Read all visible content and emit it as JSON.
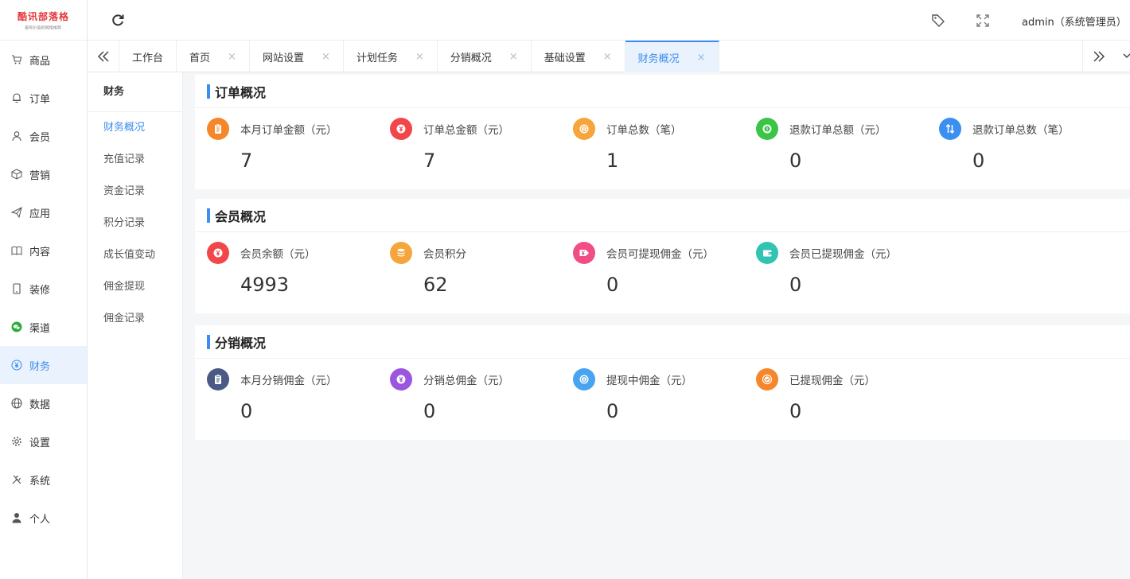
{
  "logo": {
    "main": "酷讯部落格",
    "sub": "最有价值的网络推荐"
  },
  "nav": [
    {
      "name": "nav-goods",
      "icon": "cart-icon",
      "label": "商品"
    },
    {
      "name": "nav-orders",
      "icon": "bell-icon",
      "label": "订单"
    },
    {
      "name": "nav-members",
      "icon": "user-icon",
      "label": "会员"
    },
    {
      "name": "nav-marketing",
      "icon": "cube-icon",
      "label": "营销"
    },
    {
      "name": "nav-apps",
      "icon": "paper-plane-icon",
      "label": "应用"
    },
    {
      "name": "nav-content",
      "icon": "book-icon",
      "label": "内容"
    },
    {
      "name": "nav-decoration",
      "icon": "tablet-icon",
      "label": "装修"
    },
    {
      "name": "nav-channels",
      "icon": "wechat-icon",
      "label": "渠道"
    },
    {
      "name": "nav-finance",
      "icon": "yen-icon",
      "label": "财务"
    },
    {
      "name": "nav-data",
      "icon": "globe-icon",
      "label": "数据"
    },
    {
      "name": "nav-settings",
      "icon": "gear-icon",
      "label": "设置"
    },
    {
      "name": "nav-system",
      "icon": "tools-icon",
      "label": "系统"
    },
    {
      "name": "nav-personal",
      "icon": "person-icon",
      "label": "个人"
    }
  ],
  "topbar": {
    "user": "admin（系统管理员）"
  },
  "tabs": [
    {
      "label": "工作台",
      "closable": false
    },
    {
      "label": "首页",
      "closable": true
    },
    {
      "label": "网站设置",
      "closable": true
    },
    {
      "label": "计划任务",
      "closable": true
    },
    {
      "label": "分销概况",
      "closable": true
    },
    {
      "label": "基础设置",
      "closable": true
    },
    {
      "label": "财务概况",
      "closable": true
    }
  ],
  "tab_close_glyph": "×",
  "submenu": {
    "title": "财务",
    "items": [
      "财务概况",
      "充值记录",
      "资金记录",
      "积分记录",
      "成长值变动",
      "佣金提现",
      "佣金记录"
    ]
  },
  "sections": [
    {
      "title": "订单概况",
      "stats": [
        {
          "label": "本月订单金额（元）",
          "value": "7",
          "icon": "clipboard-icon",
          "color": "#f5862a"
        },
        {
          "label": "订单总金额（元）",
          "value": "7",
          "icon": "yen-icon",
          "color": "#f2474a"
        },
        {
          "label": "订单总数（笔）",
          "value": "1",
          "icon": "coin-icon",
          "color": "#f6a53c"
        },
        {
          "label": "退款订单总额（元）",
          "value": "0",
          "icon": "refund-coin-icon",
          "color": "#3cc447"
        },
        {
          "label": "退款订单总数（笔）",
          "value": "0",
          "icon": "arrows-icon",
          "color": "#3a8ff0"
        }
      ]
    },
    {
      "title": "会员概况",
      "stats": [
        {
          "label": "会员余额（元）",
          "value": "4993",
          "icon": "yen-icon",
          "color": "#f2474a"
        },
        {
          "label": "会员积分",
          "value": "62",
          "icon": "coins-stack-icon",
          "color": "#f6a53c"
        },
        {
          "label": "会员可提现佣金（元）",
          "value": "0",
          "icon": "yen-arrow-icon",
          "color": "#f04e84"
        },
        {
          "label": "会员已提现佣金（元）",
          "value": "0",
          "icon": "wallet-icon",
          "color": "#31c4b3"
        }
      ]
    },
    {
      "title": "分销概况",
      "stats": [
        {
          "label": "本月分销佣金（元）",
          "value": "0",
          "icon": "clipboard-icon",
          "color": "#4b5a85"
        },
        {
          "label": "分销总佣金（元）",
          "value": "0",
          "icon": "yen-icon",
          "color": "#9b55e0"
        },
        {
          "label": "提现中佣金（元）",
          "value": "0",
          "icon": "coin-icon",
          "color": "#48a3f0"
        },
        {
          "label": "已提现佣金（元）",
          "value": "0",
          "icon": "check-coin-icon",
          "color": "#f5862a"
        }
      ]
    }
  ],
  "colors": {
    "accent": "#3c8df0",
    "active_bg": "#eaf3fd"
  }
}
